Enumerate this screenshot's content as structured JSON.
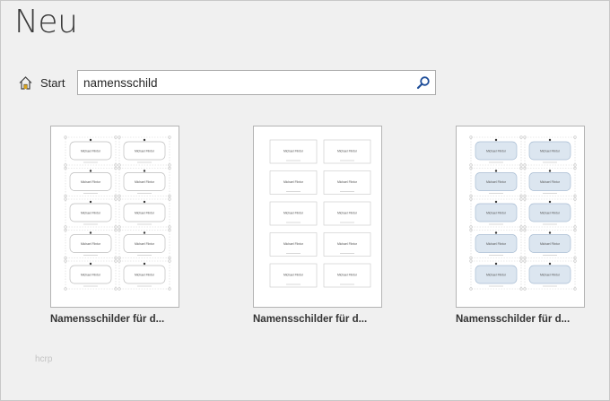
{
  "title": "Neu",
  "home": {
    "label": "Start",
    "icon": "home-icon"
  },
  "search": {
    "value": "namensschild",
    "icon": "search-icon"
  },
  "templates": [
    {
      "caption": "Namensschilder für d...",
      "style": "rounded-corner-marks"
    },
    {
      "caption": "Namensschilder für d...",
      "style": "plain-boxes"
    },
    {
      "caption": "Namensschilder für d...",
      "style": "blue-rounded-corner-marks"
    }
  ],
  "label_text": "Michael Flintor",
  "watermark": "hcrp",
  "colors": {
    "background": "#f0f0f0",
    "search_icon": "#1f4e99",
    "label_blue": "#dce6f0"
  }
}
